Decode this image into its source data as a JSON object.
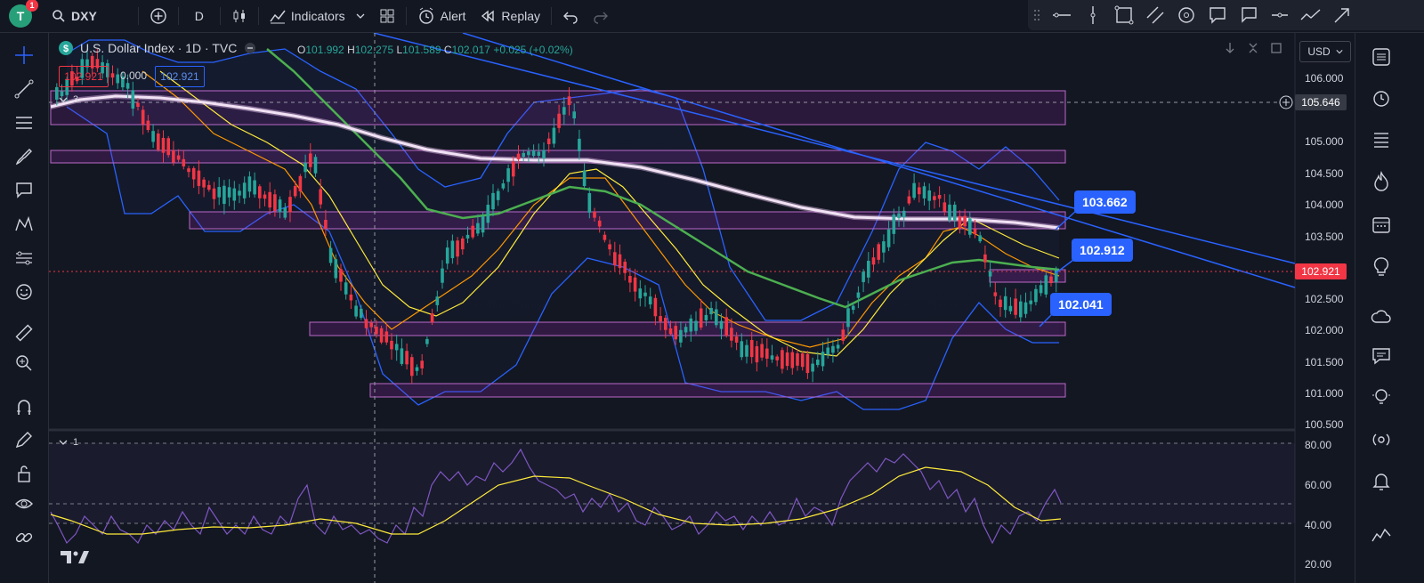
{
  "topbar": {
    "avatar_letter": "T",
    "notification_count": "1",
    "symbol": "DXY",
    "interval": "D",
    "indicators_label": "Indicators",
    "alert_label": "Alert",
    "replay_label": "Replay"
  },
  "chart": {
    "title": "U.S. Dollar Index · 1D · TVC",
    "ohlc": {
      "o_label": "O",
      "o": "101.992",
      "h_label": "H",
      "h": "102.275",
      "l_label": "L",
      "l": "101.589",
      "c_label": "C",
      "c": "102.017",
      "change": "+0.025 (+0.02%)"
    },
    "bid": "102.921",
    "spread": "0.000",
    "ask": "102.921",
    "currency": "USD",
    "main_pane_indicator_count": "3",
    "rsi_pane_indicator_count": "1",
    "price_axis": [
      "106.000",
      "105.000",
      "104.500",
      "104.000",
      "103.500",
      "103.000",
      "102.500",
      "102.000",
      "101.500",
      "101.000",
      "100.500"
    ],
    "rsi_axis": [
      "80.00",
      "60.00",
      "40.00",
      "20.00"
    ],
    "crosshair_price": "105.646",
    "last_price": "102.921",
    "callouts": [
      "103.662",
      "102.912",
      "102.041"
    ],
    "colors": {
      "background": "#131722",
      "bull": "#26a69a",
      "bear": "#f23645",
      "sma200": "#ffffff",
      "sma50": "#4caf50",
      "ema": "#ff9800",
      "sma": "#ffeb3b",
      "bollinger": "#2962ff",
      "zone": "#9c27b0",
      "trendline": "#2962ff",
      "rsi": "#7e57c2",
      "rsi_ma": "#ffeb3b",
      "accent": "#2962ff"
    }
  }
}
